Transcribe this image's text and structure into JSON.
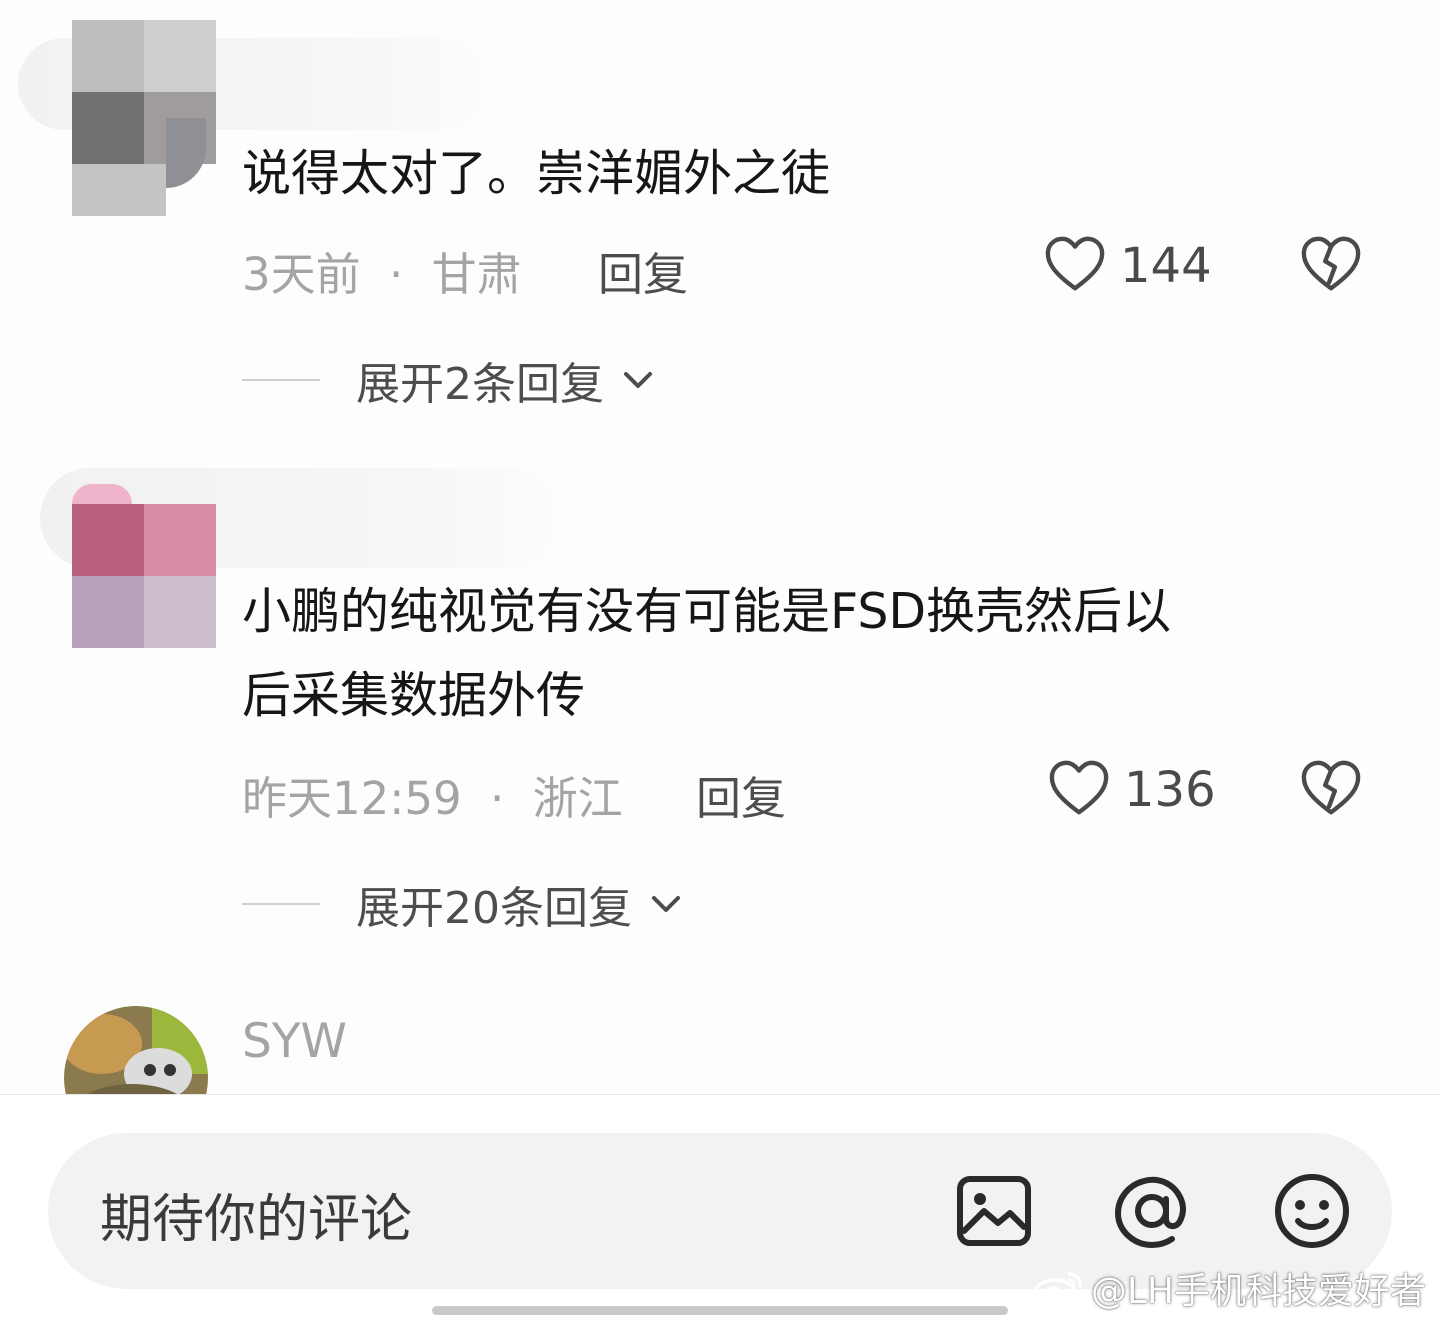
{
  "comments": [
    {
      "text": "说得太对了。崇洋媚外之徒",
      "time": "3天前",
      "separator": "·",
      "location": "甘肃",
      "reply_label": "回复",
      "likes": "144",
      "expand_label": "展开2条回复"
    },
    {
      "text_line1": "小鹏的纯视觉有没有可能是FSD换壳然后以",
      "text_line2": "后采集数据外传",
      "time": "昨天12:59",
      "separator": "·",
      "location": "浙江",
      "reply_label": "回复",
      "likes": "136",
      "expand_label": "展开20条回复"
    },
    {
      "username": "SYW"
    }
  ],
  "composer": {
    "placeholder": "期待你的评论",
    "icons": [
      "image-icon",
      "at-icon",
      "emoji-icon"
    ]
  },
  "watermark": "@LH手机科技爱好者",
  "colors": {
    "text_primary": "#161616",
    "text_secondary": "#a4a4a4",
    "action_text": "#4d4d4d",
    "input_bg": "#f2f2f2"
  }
}
